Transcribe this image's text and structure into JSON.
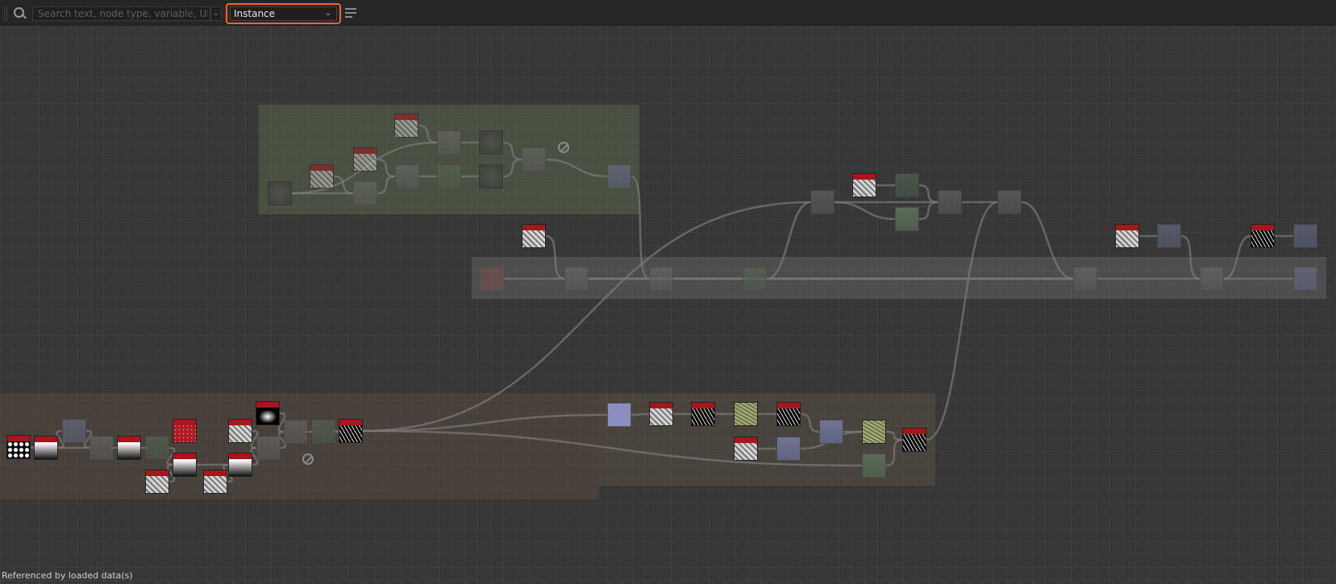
{
  "toolbar": {
    "search_placeholder": "Search text, node type, variable, UID",
    "search_icon": "search-icon",
    "filter_value": "Instance",
    "filter_highlight_color": "#f26430",
    "filter_options_icon": "filter-list-icon"
  },
  "status_text": "Referenced by loaded data(s)",
  "colors": {
    "canvas": "#373737",
    "output_header": "#a8161c"
  }
}
